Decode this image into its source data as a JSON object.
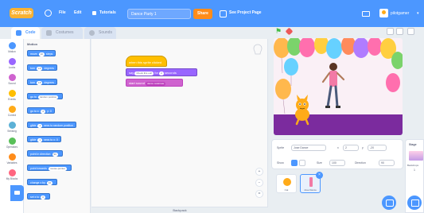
{
  "menubar": {
    "logo": "Scratch",
    "file": "File",
    "edit": "Edit",
    "tutorials": "Tutorials",
    "project_title": "Dance Party 1",
    "share": "Share",
    "see_project_page": "See Project Page",
    "username": "pilotgamer",
    "bg_color": "#4c97ff",
    "accent_color": "#ff8c1a"
  },
  "tabs": {
    "code": "Code",
    "costumes": "Costumes",
    "sounds": "Sounds"
  },
  "categories": [
    {
      "label": "Motion",
      "color": "#4c97ff"
    },
    {
      "label": "Looks",
      "color": "#9966ff"
    },
    {
      "label": "Sound",
      "color": "#cf63cf"
    },
    {
      "label": "Events",
      "color": "#ffbf00"
    },
    {
      "label": "Control",
      "color": "#ffab19"
    },
    {
      "label": "Sensing",
      "color": "#5cb1d6"
    },
    {
      "label": "Operators",
      "color": "#59c059"
    },
    {
      "label": "Variables",
      "color": "#ff8c1a"
    },
    {
      "label": "My Blocks",
      "color": "#ff6680"
    }
  ],
  "palette": {
    "title": "Motion",
    "blocks": [
      {
        "text": "move",
        "pill": "10",
        "after": "steps"
      },
      {
        "text": "turn",
        "pill": "15",
        "after": "degrees"
      },
      {
        "text": "turn",
        "pill": "15",
        "after": "degrees"
      },
      {
        "text": "go to",
        "pill": "random position",
        "after": ""
      },
      {
        "text": "go to x:",
        "pill": "0",
        "after": "y: 0"
      },
      {
        "text": "glide",
        "pill": "1",
        "after": "secs to random position"
      },
      {
        "text": "glide",
        "pill": "1",
        "after": "secs to x: 0"
      },
      {
        "text": "point in direction",
        "pill": "90",
        "after": ""
      },
      {
        "text": "point towards",
        "pill": "mouse-pointer",
        "after": ""
      },
      {
        "text": "change x by",
        "pill": "10",
        "after": ""
      },
      {
        "text": "set x to",
        "pill": "0",
        "after": ""
      }
    ]
  },
  "script": {
    "hat": "when this sprite clicked",
    "say_prefix": "say",
    "say_value": "Check this out!",
    "say_for": "for",
    "say_secs": "2",
    "say_suffix": "seconds",
    "start_sound": "start sound",
    "sound_name": "dance celebrate"
  },
  "backpack": "Backpack",
  "sprite_info": {
    "sprite_label": "Sprite",
    "sprite_name": "Jose Dance",
    "x_label": "x",
    "x_value": "2",
    "y_label": "y",
    "y_value": "-20",
    "show_label": "Show",
    "size_label": "Size",
    "size_value": "100",
    "direction_label": "Direction",
    "direction_value": "90"
  },
  "sprites": [
    {
      "name": "Cat",
      "selected": false
    },
    {
      "name": "Jose Dance",
      "selected": true
    }
  ],
  "stage_panel": {
    "label": "Stage",
    "backdrops_label": "Backdrops",
    "backdrops_count": "1"
  }
}
